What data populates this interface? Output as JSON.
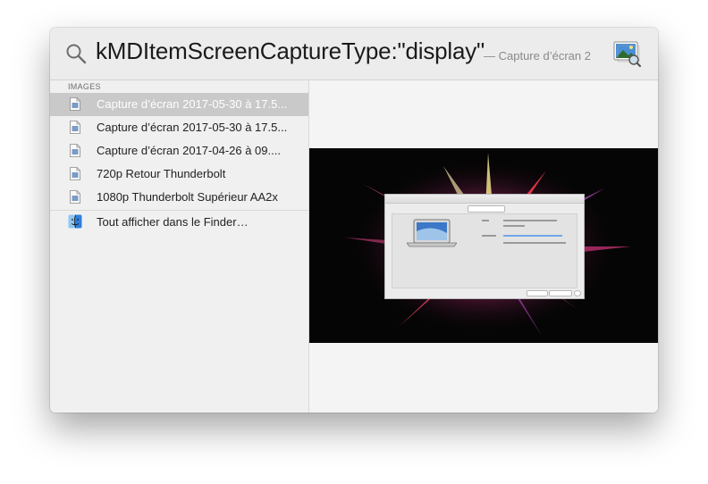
{
  "search": {
    "query": "kMDItemScreenCaptureType:\"display\"",
    "hint": "— Capture d’écran 2"
  },
  "sidebar": {
    "section_header": "IMAGES",
    "items": [
      {
        "label": "Capture d’écran 2017-05-30 à 17.5...",
        "icon": "image-file-icon",
        "selected": true
      },
      {
        "label": "Capture d’écran 2017-05-30 à 17.5...",
        "icon": "image-file-icon",
        "selected": false
      },
      {
        "label": "Capture d’écran 2017-04-26 à 09....",
        "icon": "image-file-icon",
        "selected": false
      },
      {
        "label": "720p Retour Thunderbolt",
        "icon": "image-file-icon",
        "selected": false
      },
      {
        "label": "1080p Thunderbolt Supérieur AA2x",
        "icon": "image-file-icon",
        "selected": false
      }
    ],
    "show_all_label": "Tout afficher dans le Finder…",
    "show_all_icon": "finder-icon"
  },
  "colors": {
    "selection": "#c9c9c9",
    "panel": "#f4f4f4",
    "search_bar": "#ececec"
  }
}
